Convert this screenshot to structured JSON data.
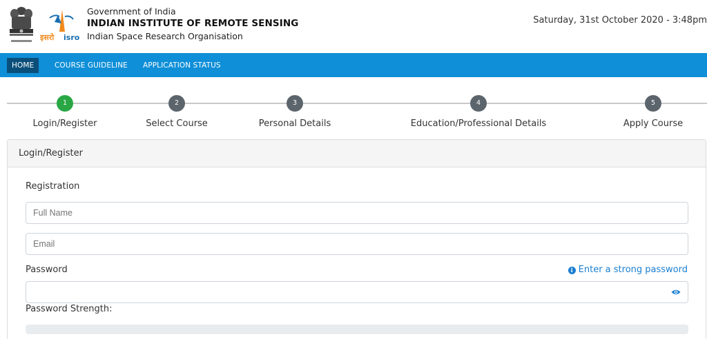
{
  "header": {
    "gov_line": "Government of India",
    "institute": "INDIAN INSTITUTE OF REMOTE SENSING",
    "org": "Indian Space Research Organisation",
    "datetime": "Saturday, 31st October 2020 - 3:48pm"
  },
  "nav": {
    "items": [
      {
        "label": "HOME",
        "active": true
      },
      {
        "label": "COURSE GUIDELINE"
      },
      {
        "label": "APPLICATION STATUS"
      }
    ]
  },
  "steps": [
    {
      "number": "1",
      "label": "Login/Register",
      "done": true
    },
    {
      "number": "2",
      "label": "Select Course"
    },
    {
      "number": "3",
      "label": "Personal Details"
    },
    {
      "number": "4",
      "label": "Education/Professional Details"
    },
    {
      "number": "5",
      "label": "Apply Course"
    }
  ],
  "card": {
    "header": "Login/Register",
    "section_title": "Registration",
    "fullname_placeholder": "Full Name",
    "email_placeholder": "Email",
    "password_label": "Password",
    "password_hint": "Enter a strong password",
    "strength_label": "Password Strength:"
  },
  "colors": {
    "nav_bg": "#0f8fd8",
    "nav_active": "#0a4f7a",
    "step_done": "#2aa745",
    "step_pending": "#5c646c",
    "link": "#1a7fd1"
  },
  "icons": {
    "emblem": "national-emblem-icon",
    "isro": "isro-logo-icon",
    "info": "info-circle-icon",
    "eye": "eye-icon"
  }
}
